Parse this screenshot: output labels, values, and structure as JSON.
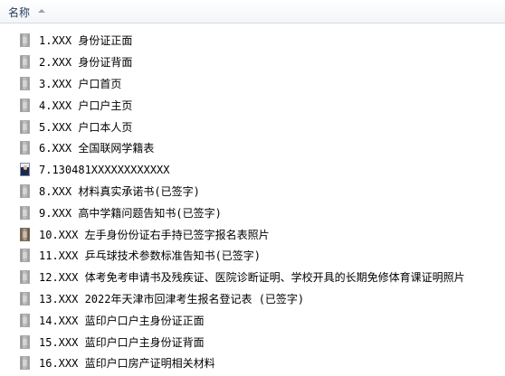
{
  "header": {
    "name_label": "名称"
  },
  "files": [
    {
      "name": "1.XXX 身份证正面",
      "icon": "scan"
    },
    {
      "name": "2.XXX 身份证背面",
      "icon": "scan"
    },
    {
      "name": "3.XXX 户口首页",
      "icon": "scan"
    },
    {
      "name": "4.XXX 户口户主页",
      "icon": "scan"
    },
    {
      "name": "5.XXX 户口本人页",
      "icon": "scan"
    },
    {
      "name": "6.XXX 全国联网学籍表",
      "icon": "scan"
    },
    {
      "name": "7.130481XXXXXXXXXXXX",
      "icon": "photo"
    },
    {
      "name": "8.XXX 材料真实承诺书(已签字)",
      "icon": "scan"
    },
    {
      "name": "9.XXX 高中学籍问题告知书(已签字)",
      "icon": "scan"
    },
    {
      "name": "10.XXX 左手身份份证右手持已签字报名表照片",
      "icon": "dark"
    },
    {
      "name": "11.XXX 乒乓球技术参数标准告知书(已签字)",
      "icon": "scan"
    },
    {
      "name": "12.XXX 体考免考申请书及残疾证、医院诊断证明、学校开具的长期免修体育课证明照片",
      "icon": "scan"
    },
    {
      "name": "13.XXX 2022年天津市回津考生报名登记表 (已签字)",
      "icon": "scan"
    },
    {
      "name": "14.XXX 蓝印户口户主身份证正面",
      "icon": "scan"
    },
    {
      "name": "15.XXX 蓝印户口户主身份证背面",
      "icon": "scan"
    },
    {
      "name": "16.XXX 蓝印户口房产证明相关材料",
      "icon": "scan"
    }
  ]
}
